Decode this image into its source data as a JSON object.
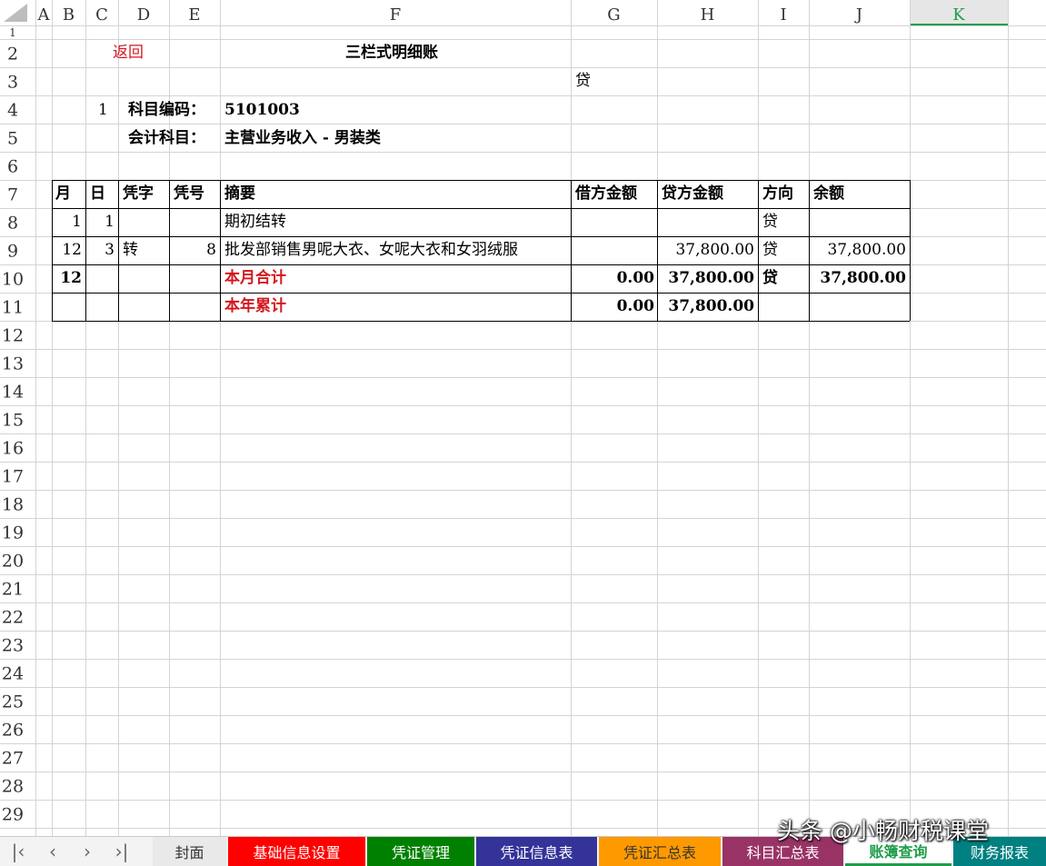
{
  "app": {
    "type": "spreadsheet"
  },
  "columns": [
    "A",
    "B",
    "C",
    "D",
    "E",
    "F",
    "G",
    "H",
    "I",
    "J",
    "K"
  ],
  "active_column": "K",
  "rows": [
    "1",
    "2",
    "3",
    "4",
    "5",
    "6",
    "7",
    "8",
    "9",
    "10",
    "11",
    "12",
    "13",
    "14",
    "15",
    "16",
    "17",
    "18",
    "19",
    "20",
    "21",
    "22",
    "23",
    "24",
    "25",
    "26",
    "27",
    "28",
    "29"
  ],
  "sheet": {
    "back_link": "返回",
    "title": "三栏式明细账",
    "direction_note": "贷",
    "index": "1",
    "code_label": "科目编码：",
    "code_value": "5101003",
    "subject_label": "会计科目：",
    "subject_value": "主营业务收入 - 男装类"
  },
  "table": {
    "headers": [
      "月",
      "日",
      "凭字",
      "凭号",
      "摘要",
      "借方金额",
      "贷方金额",
      "方向",
      "余额"
    ],
    "rows": [
      {
        "month": "1",
        "day": "1",
        "vtype": "",
        "vno": "",
        "summary": "期初结转",
        "debit": "",
        "credit": "",
        "dir": "贷",
        "balance": ""
      },
      {
        "month": "12",
        "day": "3",
        "vtype": "转",
        "vno": "8",
        "summary": "批发部销售男呢大衣、女呢大衣和女羽绒服",
        "debit": "",
        "credit": "37,800.00",
        "dir": "贷",
        "balance": "37,800.00"
      }
    ],
    "month_total": {
      "month": "12",
      "summary": "本月合计",
      "debit": "0.00",
      "credit": "37,800.00",
      "dir": "贷",
      "balance": "37,800.00"
    },
    "year_total": {
      "summary": "本年累计",
      "debit": "0.00",
      "credit": "37,800.00"
    }
  },
  "tabs": [
    {
      "label": "封面",
      "color": "#e9e9e9",
      "text": "#333333"
    },
    {
      "label": "基础信息设置",
      "color": "#ff0000",
      "text": "#ffffff"
    },
    {
      "label": "凭证管理",
      "color": "#008000",
      "text": "#ffffff"
    },
    {
      "label": "凭证信息表",
      "color": "#333399",
      "text": "#ffffff"
    },
    {
      "label": "凭证汇总表",
      "color": "#ff9900",
      "text": "#333333"
    },
    {
      "label": "科目汇总表",
      "color": "#993366",
      "text": "#ffffff"
    },
    {
      "label": "账簿查询",
      "color": "#ffffff",
      "text": "#1f9d4a"
    },
    {
      "label": "财务报表",
      "color": "#008080",
      "text": "#ffffff"
    }
  ],
  "active_tab": 6,
  "nav_icons": [
    "first-sheet-icon",
    "prev-sheet-icon",
    "next-sheet-icon",
    "last-sheet-icon"
  ],
  "watermark": "头条 @小畅财税课堂",
  "colors": {
    "grid": "#d4d4d4",
    "header_bg": "#ffffff",
    "accent": "#1f9d4a",
    "red_text": "#d3181f"
  }
}
